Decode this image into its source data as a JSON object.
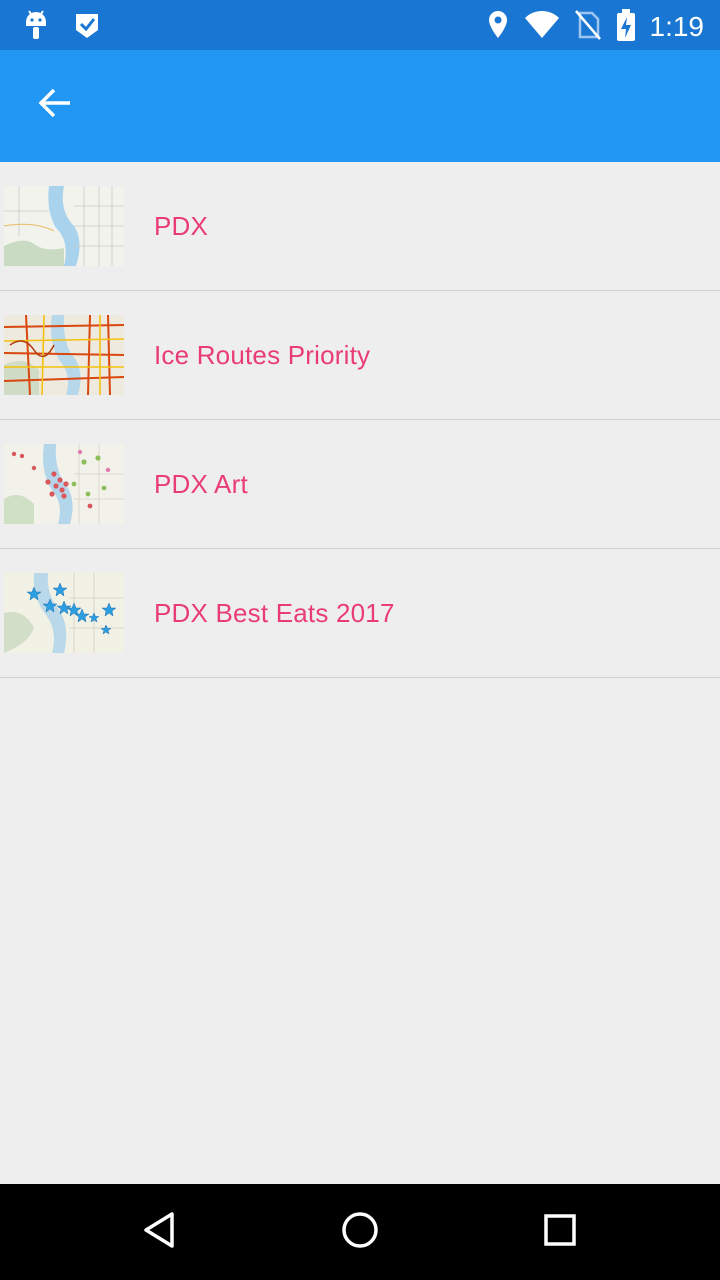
{
  "status_bar": {
    "time": "1:19",
    "icons": [
      "android-debug-icon",
      "check-notification-icon",
      "location-icon",
      "wifi-icon",
      "no-sim-icon",
      "battery-charging-icon"
    ]
  },
  "app_bar": {
    "back_icon": "arrow-back-icon"
  },
  "items": [
    {
      "title": "PDX",
      "thumbnail": "street-map-thumbnail"
    },
    {
      "title": "Ice Routes Priority",
      "thumbnail": "ice-routes-map-thumbnail"
    },
    {
      "title": "PDX Art",
      "thumbnail": "art-points-map-thumbnail"
    },
    {
      "title": "PDX Best Eats 2017",
      "thumbnail": "star-points-map-thumbnail"
    }
  ],
  "nav_bar": {
    "icons": [
      "back-triangle-icon",
      "home-circle-icon",
      "recents-square-icon"
    ]
  },
  "colors": {
    "status_bar": "#1976d2",
    "app_bar": "#2196f3",
    "background": "#eeeeee",
    "item_title": "#e91e63",
    "nav_bar": "#000000"
  }
}
